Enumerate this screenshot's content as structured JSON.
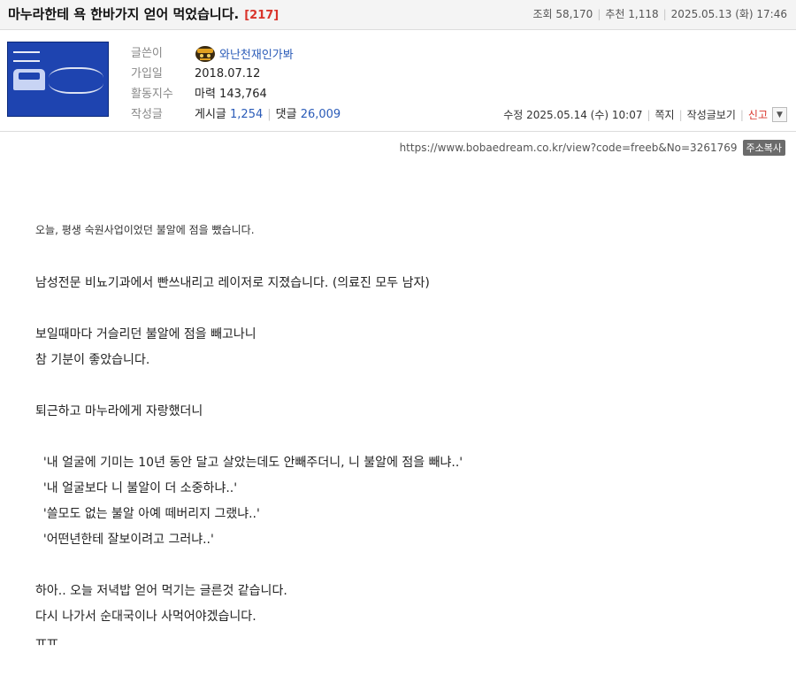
{
  "header": {
    "title": "마누라한테 욕 한바가지 얻어 먹었습니다.",
    "comment_count": "[217]",
    "views": "조회 58,170",
    "recommends": "추천 1,118",
    "date": "2025.05.13 (화) 17:46"
  },
  "profile": {
    "labels": [
      "글쓴이",
      "가입일",
      "활동지수",
      "작성글"
    ],
    "nickname": "와난천재인가봐",
    "joined": "2018.07.12",
    "activity": "마력 143,764",
    "posts_label": "게시글",
    "posts_count": "1,254",
    "comments_label": "댓글",
    "comments_count": "26,009"
  },
  "actions": {
    "edited": "수정 2025.05.14 (수) 10:07",
    "message": "쪽지",
    "view_posts": "작성글보기",
    "report": "신고"
  },
  "url": {
    "text": "https://www.bobaedream.co.kr/view?code=freeb&No=3261769",
    "copy_label": "주소복사"
  },
  "body": {
    "intro": "오늘, 평생 숙원사업이었던 불알에 점을 뺐습니다.",
    "lines": [
      "남성전문 비뇨기과에서 빤쓰내리고 레이저로 지졌습니다. (의료진 모두 남자)",
      "",
      "보일때마다 거슬리던 불알에 점을 빼고나니",
      "참 기분이 좋았습니다.",
      "",
      "퇴근하고 마누라에게 자랑했더니",
      "",
      "  '내 얼굴에 기미는 10년 동안 달고 살았는데도 안빼주더니, 니 불알에 점을 빼냐..'",
      "  '내 얼굴보다 니 불알이 더 소중하냐..'",
      "  '쓸모도 없는 불알 아예 떼버리지 그랬냐..'",
      "  '어떤년한테 잘보이려고 그러냐..'",
      "",
      "하아.. 오늘 저녁밥 얻어 먹기는 글른것 같습니다.",
      "다시 나가서 순대국이나 사먹어야겠습니다.",
      "ㅠㅠ"
    ]
  },
  "colors": {
    "accent_red": "#d9342b",
    "link_blue": "#2a5bb8"
  }
}
